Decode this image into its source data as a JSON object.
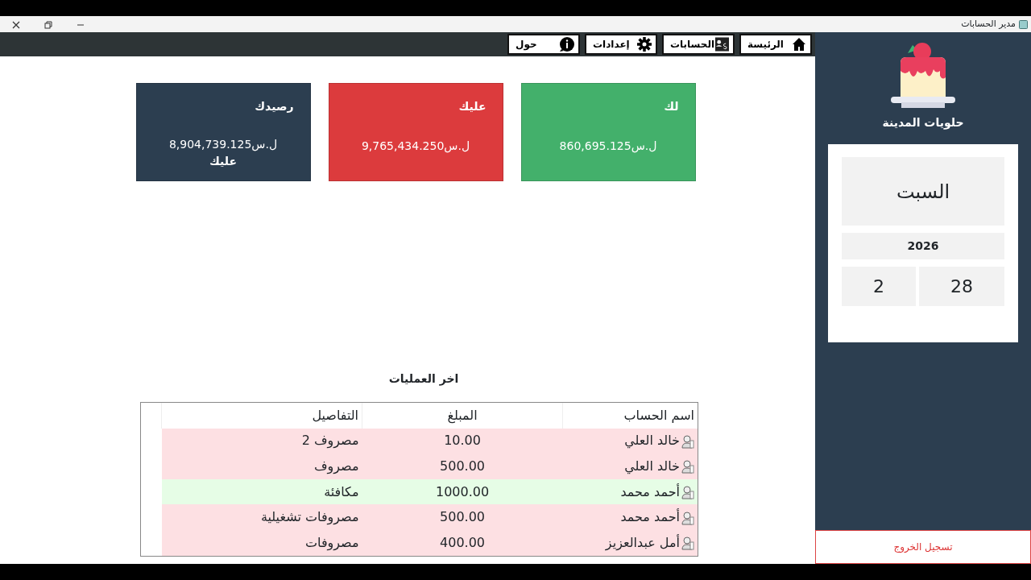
{
  "window": {
    "title": "مدير الحسابات"
  },
  "nav": [
    {
      "label": "الرئيسة",
      "kind": "home"
    },
    {
      "label": "الحسابات",
      "kind": "accounts"
    },
    {
      "label": "إعدادات",
      "kind": "settings"
    },
    {
      "label": "حول",
      "kind": "about"
    }
  ],
  "cards": [
    {
      "title": "لك",
      "value": "ل.س860,695.125",
      "color": "#43b06b"
    },
    {
      "title": "عليك",
      "value": "ل.س9,765,434.250",
      "color": "#dc3b3d"
    },
    {
      "title": "رصيدك",
      "value": "ل.س8,904,739.125",
      "note": "عليك",
      "color": "#2c3e50"
    }
  ],
  "transactions": {
    "title": "اخر العمليات",
    "columns": [
      "اسم الحساب",
      "المبلغ",
      "التفاصيل"
    ],
    "rows": [
      {
        "kind": "expense",
        "cells": [
          "خالد العلي",
          "10.00",
          "مصروف 2"
        ]
      },
      {
        "kind": "expense",
        "cells": [
          "خالد العلي",
          "500.00",
          "مصروف"
        ]
      },
      {
        "kind": "income",
        "cells": [
          "أحمد محمد",
          "1000.00",
          "مكافئة"
        ]
      },
      {
        "kind": "expense",
        "cells": [
          "أحمد محمد",
          "500.00",
          "مصروفات تشغيلية"
        ]
      },
      {
        "kind": "expense",
        "cells": [
          "أمل عبدالعزيز",
          "400.00",
          "مصروفات"
        ]
      }
    ]
  },
  "sidebar": {
    "shop_name": "حلويات المدينة",
    "date": {
      "weekday": "السبت",
      "year": "2026",
      "day": "28",
      "month": "2"
    },
    "logout": "تسجيل الخروج"
  }
}
